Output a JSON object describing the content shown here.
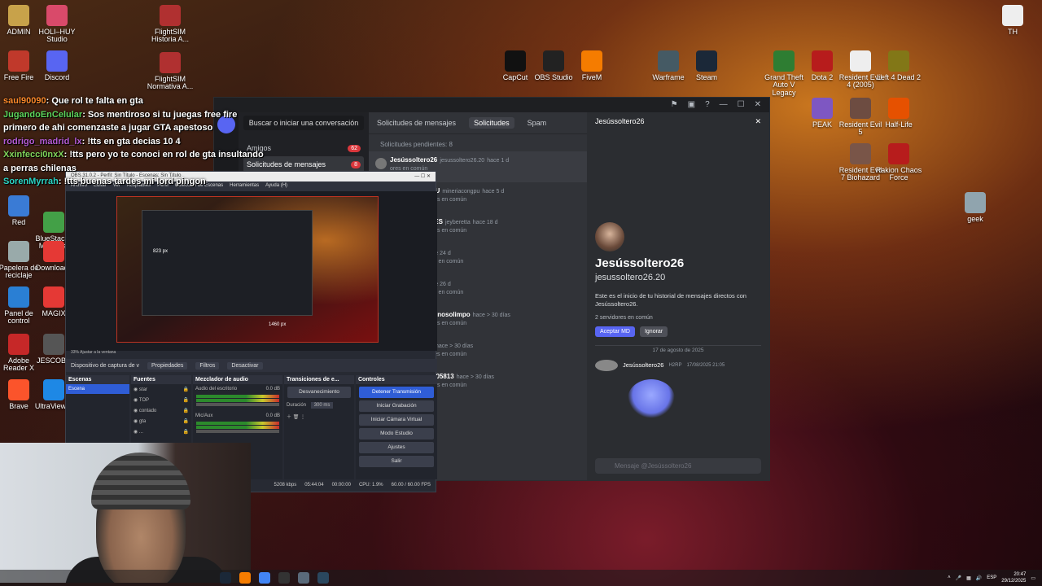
{
  "desktop_icons_left": [
    {
      "label": "ADMIN",
      "icon": "user-folder-icon",
      "color": "#c8a24a"
    },
    {
      "label": "HOLI–HUY Studio",
      "icon": "app-icon",
      "color": "#d94a6a"
    },
    {
      "label": "Free Fire",
      "icon": "game-icon",
      "color": "#c0392b"
    },
    {
      "label": "Discord",
      "icon": "discord-icon",
      "color": "#5865f2"
    },
    {
      "label": "Red",
      "icon": "network-icon",
      "color": "#3a7bd5"
    },
    {
      "label": "BlueStacks Multi-Inst",
      "icon": "bluestacks-icon",
      "color": "#43a047"
    },
    {
      "label": "Papelera de reciclaje",
      "icon": "recycle-bin-icon",
      "color": "#9aa"
    },
    {
      "label": "Downloads",
      "icon": "folder-icon",
      "color": "#e53935"
    },
    {
      "label": "Panel de control",
      "icon": "control-panel-icon",
      "color": "#2a7fd4"
    },
    {
      "label": "MAGIX",
      "icon": "app-icon",
      "color": "#e53935"
    },
    {
      "label": "Adobe Reader X",
      "icon": "pdf-icon",
      "color": "#c62828"
    },
    {
      "label": "JESCOBA",
      "icon": "app-icon",
      "color": "#555"
    },
    {
      "label": "Brave",
      "icon": "brave-icon",
      "color": "#fb542b"
    },
    {
      "label": "UltraViewer",
      "icon": "app-icon",
      "color": "#1e88e5"
    }
  ],
  "desktop_icons_mid": [
    {
      "label": "FlightSIM Historia A...",
      "icon": "app-icon",
      "color": "#b03030"
    },
    {
      "label": "FlightSIM Normativa A...",
      "icon": "app-icon",
      "color": "#b03030"
    }
  ],
  "desktop_icons_top": [
    {
      "label": "CapCut",
      "icon": "capcut-icon",
      "color": "#111"
    },
    {
      "label": "OBS Studio",
      "icon": "obs-icon",
      "color": "#222"
    },
    {
      "label": "FiveM",
      "icon": "fivem-icon",
      "color": "#f57c00"
    },
    {
      "label": "Warframe",
      "icon": "warframe-icon",
      "color": "#455a64"
    },
    {
      "label": "Steam",
      "icon": "steam-icon",
      "color": "#1b2838"
    }
  ],
  "desktop_icons_right": [
    {
      "label": "Grand Theft Auto V Legacy",
      "icon": "gta-icon",
      "color": "#2e7d32"
    },
    {
      "label": "Dota 2",
      "icon": "dota-icon",
      "color": "#b71c1c"
    },
    {
      "label": "Resident Evil 4 (2005)",
      "icon": "game-icon",
      "color": "#eee"
    },
    {
      "label": "Left 4 Dead 2",
      "icon": "game-icon",
      "color": "#827717"
    },
    {
      "label": "PEAK",
      "icon": "game-icon",
      "color": "#7e57c2"
    },
    {
      "label": "Resident Evil 5",
      "icon": "game-icon",
      "color": "#6d4c41"
    },
    {
      "label": "Half-Life",
      "icon": "half-life-icon",
      "color": "#e65100"
    },
    {
      "label": "Resident Evil 7 Biohazard",
      "icon": "game-icon",
      "color": "#795548"
    },
    {
      "label": "Rakion Chaos Force",
      "icon": "game-icon",
      "color": "#b71c1c"
    },
    {
      "label": "geek",
      "icon": "geek-icon",
      "color": "#90a4ae"
    },
    {
      "label": "TH",
      "icon": "file-icon",
      "color": "#eee"
    }
  ],
  "chat": [
    {
      "user": "saul90090",
      "color": "#ff8a2a",
      "text": "Que rol te falta en gta"
    },
    {
      "user": "JugandoEnCelular",
      "color": "#5bd45b",
      "text": "Sos mentiroso si tu juegas free fire primero de ahi comenzaste a jugar GTA apestoso"
    },
    {
      "user": "rodrigo_madrid_lx",
      "color": "#b45bd4",
      "text": "!tts en gta decias 10 4"
    },
    {
      "user": "Xxinfecci0nxX",
      "color": "#7fd45b",
      "text": "!tts pero yo te conoci en rol de gta insultando a perras chilenas"
    },
    {
      "user": "SorenMyrrah",
      "color": "#2ad4c4",
      "text": "!tts buenas tardes mi lord pingon"
    }
  ],
  "discord": {
    "search_placeholder": "Buscar o iniciar una conversación",
    "nav": [
      {
        "label": "Amigos",
        "badge": "62",
        "icon": "friends-icon"
      },
      {
        "label": "Solicitudes de mensajes",
        "badge": "8",
        "icon": "message-request-icon"
      }
    ],
    "tabs": {
      "title": "Solicitudes de mensajes",
      "solicitudes": "Solicitudes",
      "spam": "Spam"
    },
    "pending": "Solicitudes pendientes: 8",
    "requests": [
      {
        "name": "Jesússoltero26",
        "user": "jesussoltero26.20",
        "time": "hace 1 d",
        "sub": "ores en común"
      },
      {
        "name": "GPU",
        "user": "mineriacongpu",
        "time": "hace 5 d",
        "sub": "dores en común"
      },
      {
        "name": "AJES",
        "user": "jeyberetta",
        "time": "hace 18 d",
        "sub": "dores en común"
      },
      {
        "name": "",
        "user": "",
        "time": "hace 24 d",
        "sub": "ores en común"
      },
      {
        "name": "",
        "user": "",
        "time": "hace 26 d",
        "sub": "ores en común"
      },
      {
        "name": "hypnosolimpo",
        "user": "",
        "time": "hace > 30 días",
        "sub": "dores en común"
      },
      {
        "name": "x1",
        "user": "",
        "time": "hace > 30 días",
        "sub": "dores en común"
      },
      {
        "name": "ro005813",
        "user": "",
        "time": "hace > 30 días",
        "sub": "dores en común"
      }
    ],
    "profile": {
      "header": "Jesússoltero26",
      "name": "Jesússoltero26",
      "username": "jesussoltero26.20",
      "description": "Este es el inicio de tu historial de mensajes directos con Jesússoltero26.",
      "servers": "2 servidores en común",
      "accept": "Aceptar MD",
      "ignore": "Ignorar",
      "date": "17 de agosto de 2025",
      "msg_name": "Jesússoltero26",
      "msg_tag": "H2RP",
      "msg_time": "17/08/2025 21:05",
      "input_placeholder": "Mensaje @Jesússoltero26"
    }
  },
  "obs": {
    "title": "OBS 31.0.2 - Perfil: Sin Título - Escenas: Sin Título",
    "menu": [
      "Archivo",
      "Editar",
      "Ver",
      "Acoplables",
      "Perfil",
      "Colección de Escenas",
      "Herramientas",
      "Ayuda (H)"
    ],
    "preview_label": "1460 px",
    "preview_label2": "823 px",
    "zoom": "Ajustar a la ventana",
    "zoom_pct": "33%",
    "source_name": "Dispositivo de captura de v",
    "props": "Propiedades",
    "filters": "Filtros",
    "deactivate": "Desactivar",
    "docks": {
      "scenes": {
        "title": "Escenas",
        "items": [
          "Escena"
        ]
      },
      "sources": {
        "title": "Fuentes",
        "items": [
          "star",
          "TOP",
          "contado",
          "gta",
          "..."
        ]
      },
      "mixer": {
        "title": "Mezclador de audio",
        "ch1": "Audio del escritorio",
        "ch1_db": "0.0 dB",
        "ch2": "Mic/Aux",
        "ch2_db": "0.0 dB"
      },
      "transitions": {
        "title": "Transiciones de e...",
        "type": "Desvanecimiento",
        "duration_label": "Duración",
        "duration": "300 ms"
      },
      "controls": {
        "title": "Controles",
        "buttons": [
          "Detener Transmisión",
          "Iniciar Grabación",
          "Iniciar Cámara Virtual",
          "Modo Estudio",
          "Ajustes",
          "Salir"
        ]
      }
    },
    "status": {
      "kbps": "5208 kbps",
      "stream_time": "05:44:04",
      "rec_time": "00:00:00",
      "cpu": "CPU: 1.9%",
      "fps": "60.00 / 60.00 FPS"
    }
  },
  "taskbar": {
    "apps": [
      {
        "icon": "steam-icon",
        "color": "#1b2838"
      },
      {
        "icon": "fivem-icon",
        "color": "#f57c00"
      },
      {
        "icon": "chrome-icon",
        "color": "#4285f4"
      },
      {
        "icon": "obs-icon",
        "color": "#333"
      },
      {
        "icon": "app-icon",
        "color": "#5a6a7a"
      },
      {
        "icon": "steam-icon",
        "color": "#2a475e"
      }
    ],
    "lang": "ESP",
    "time": "20:47",
    "date": "29/12/2025"
  }
}
